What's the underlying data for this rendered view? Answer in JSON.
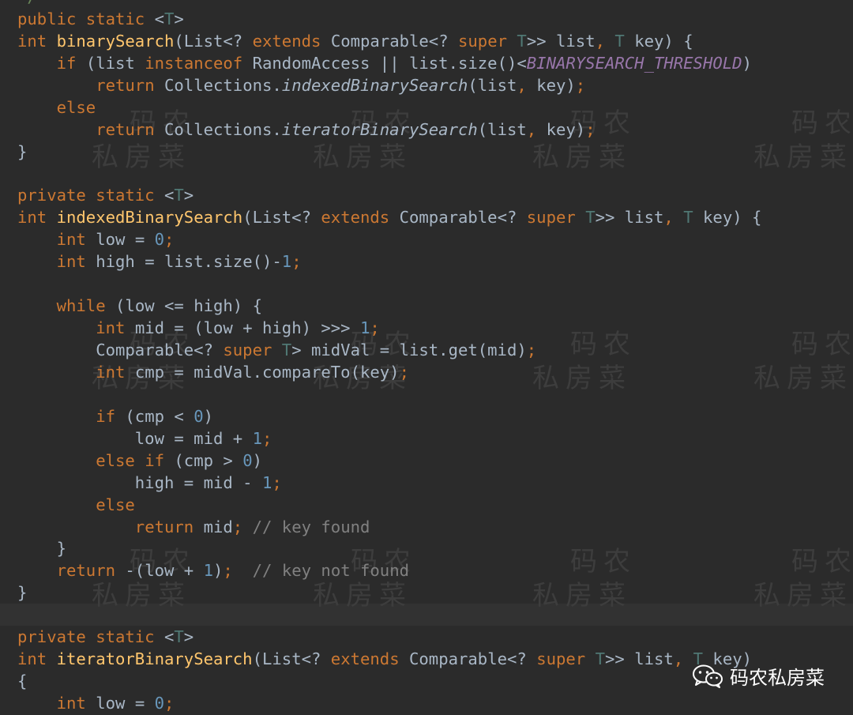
{
  "editor": {
    "lines": [
      [
        [
          "ann",
          "*/"
        ]
      ],
      [
        [
          "kw",
          "public static "
        ],
        [
          "p",
          "<"
        ],
        [
          "tp",
          "T"
        ],
        [
          "p",
          ">"
        ]
      ],
      [
        [
          "kw",
          "int "
        ],
        [
          "fn",
          "binarySearch"
        ],
        [
          "p",
          "(List<? "
        ],
        [
          "kw",
          "extends "
        ],
        [
          "p",
          "Comparable<? "
        ],
        [
          "kw",
          "super "
        ],
        [
          "tp",
          "T"
        ],
        [
          "p",
          ">> list"
        ],
        [
          "kw",
          ", "
        ],
        [
          "tp",
          "T "
        ],
        [
          "p",
          "key) {"
        ]
      ],
      [
        [
          "p",
          "    "
        ],
        [
          "kw",
          "if "
        ],
        [
          "p",
          "(list "
        ],
        [
          "kw",
          "instanceof "
        ],
        [
          "p",
          "RandomAccess || list.size()<"
        ],
        [
          "cst",
          "BINARYSEARCH_THRESHOLD"
        ],
        [
          "p",
          ")"
        ]
      ],
      [
        [
          "p",
          "        "
        ],
        [
          "kw",
          "return "
        ],
        [
          "p",
          "Collections."
        ],
        [
          "it",
          "indexedBinarySearch"
        ],
        [
          "p",
          "(list"
        ],
        [
          "kw",
          ", "
        ],
        [
          "p",
          "key)"
        ],
        [
          "kw",
          ";"
        ]
      ],
      [
        [
          "p",
          "    "
        ],
        [
          "kw",
          "else"
        ]
      ],
      [
        [
          "p",
          "        "
        ],
        [
          "kw",
          "return "
        ],
        [
          "p",
          "Collections."
        ],
        [
          "it",
          "iteratorBinarySearch"
        ],
        [
          "p",
          "(list"
        ],
        [
          "kw",
          ", "
        ],
        [
          "p",
          "key)"
        ],
        [
          "kw",
          ";"
        ]
      ],
      [
        [
          "p",
          "}"
        ]
      ],
      [],
      [
        [
          "kw",
          "private static "
        ],
        [
          "p",
          "<"
        ],
        [
          "tp",
          "T"
        ],
        [
          "p",
          ">"
        ]
      ],
      [
        [
          "kw",
          "int "
        ],
        [
          "fn",
          "indexedBinarySearch"
        ],
        [
          "p",
          "(List<? "
        ],
        [
          "kw",
          "extends "
        ],
        [
          "p",
          "Comparable<? "
        ],
        [
          "kw",
          "super "
        ],
        [
          "tp",
          "T"
        ],
        [
          "p",
          ">> list"
        ],
        [
          "kw",
          ", "
        ],
        [
          "tp",
          "T "
        ],
        [
          "p",
          "key) {"
        ]
      ],
      [
        [
          "p",
          "    "
        ],
        [
          "kw",
          "int "
        ],
        [
          "p",
          "low = "
        ],
        [
          "num",
          "0"
        ],
        [
          "kw",
          ";"
        ]
      ],
      [
        [
          "p",
          "    "
        ],
        [
          "kw",
          "int "
        ],
        [
          "p",
          "high = list.size()-"
        ],
        [
          "num",
          "1"
        ],
        [
          "kw",
          ";"
        ]
      ],
      [],
      [
        [
          "p",
          "    "
        ],
        [
          "kw",
          "while "
        ],
        [
          "p",
          "(low <= high) {"
        ]
      ],
      [
        [
          "p",
          "        "
        ],
        [
          "kw",
          "int "
        ],
        [
          "p",
          "mid = (low + high) >>> "
        ],
        [
          "num",
          "1"
        ],
        [
          "kw",
          ";"
        ]
      ],
      [
        [
          "p",
          "        Comparable<? "
        ],
        [
          "kw",
          "super "
        ],
        [
          "tp",
          "T"
        ],
        [
          "p",
          "> midVal = list.get(mid)"
        ],
        [
          "kw",
          ";"
        ]
      ],
      [
        [
          "p",
          "        "
        ],
        [
          "kw",
          "int "
        ],
        [
          "p",
          "cmp = midVal.compareTo(key)"
        ],
        [
          "kw",
          ";"
        ]
      ],
      [],
      [
        [
          "p",
          "        "
        ],
        [
          "kw",
          "if "
        ],
        [
          "p",
          "(cmp < "
        ],
        [
          "num",
          "0"
        ],
        [
          "p",
          ")"
        ]
      ],
      [
        [
          "p",
          "            low = mid + "
        ],
        [
          "num",
          "1"
        ],
        [
          "kw",
          ";"
        ]
      ],
      [
        [
          "p",
          "        "
        ],
        [
          "kw",
          "else if "
        ],
        [
          "p",
          "(cmp > "
        ],
        [
          "num",
          "0"
        ],
        [
          "p",
          ")"
        ]
      ],
      [
        [
          "p",
          "            high = mid - "
        ],
        [
          "num",
          "1"
        ],
        [
          "kw",
          ";"
        ]
      ],
      [
        [
          "p",
          "        "
        ],
        [
          "kw",
          "else"
        ]
      ],
      [
        [
          "p",
          "            "
        ],
        [
          "kw",
          "return "
        ],
        [
          "p",
          "mid"
        ],
        [
          "kw",
          "; "
        ],
        [
          "cmt",
          "// key found"
        ]
      ],
      [
        [
          "p",
          "    }"
        ]
      ],
      [
        [
          "p",
          "    "
        ],
        [
          "kw",
          "return "
        ],
        [
          "p",
          "-(low + "
        ],
        [
          "num",
          "1"
        ],
        [
          "p",
          ")"
        ],
        [
          "kw",
          ";  "
        ],
        [
          "cmt",
          "// key not found"
        ]
      ],
      [
        [
          "p",
          "}"
        ]
      ],
      [],
      [
        [
          "kw",
          "private static "
        ],
        [
          "p",
          "<"
        ],
        [
          "tp",
          "T"
        ],
        [
          "p",
          ">"
        ]
      ],
      [
        [
          "kw",
          "int "
        ],
        [
          "fn",
          "iteratorBinarySearch"
        ],
        [
          "p",
          "(List<? "
        ],
        [
          "kw",
          "extends "
        ],
        [
          "p",
          "Comparable<? "
        ],
        [
          "kw",
          "super "
        ],
        [
          "tp",
          "T"
        ],
        [
          "p",
          ">> list"
        ],
        [
          "kw",
          ", "
        ],
        [
          "tp",
          "T "
        ],
        [
          "p",
          "key)"
        ]
      ],
      [
        [
          "p",
          "{"
        ]
      ],
      [
        [
          "p",
          "    "
        ],
        [
          "kw",
          "int "
        ],
        [
          "p",
          "low = "
        ],
        [
          "num",
          "0"
        ],
        [
          "kw",
          ";"
        ]
      ]
    ]
  },
  "watermark": {
    "line1": "码农",
    "line2": "私房菜"
  },
  "badge": {
    "label": "码农私房菜",
    "icon": "wechat-icon"
  }
}
